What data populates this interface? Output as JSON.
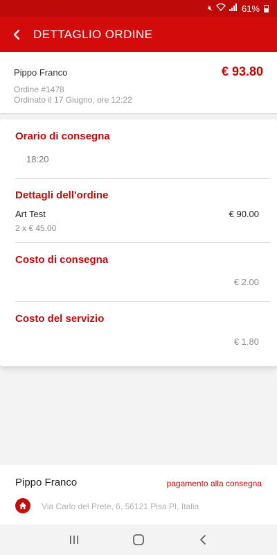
{
  "status_bar": {
    "battery_text": "61%",
    "icons": [
      "mute-icon",
      "wifi-icon",
      "signal-icon",
      "battery-icon"
    ]
  },
  "header": {
    "title": "DETTAGLIO ORDINE",
    "back_icon": "back-arrow-icon"
  },
  "summary": {
    "customer": "Pippo Franco",
    "total": "€ 93.80",
    "order_id": "Ordine #1478",
    "ordered_at": "Ordinato il 17 Giugno, ore 12:22"
  },
  "delivery_time": {
    "title": "Orario di consegna",
    "value": "18:20"
  },
  "order_details": {
    "title": "Dettagli dell'ordine",
    "items": [
      {
        "name": "Art Test",
        "price": "€ 90.00",
        "qty": "2 x € 45.00"
      }
    ]
  },
  "delivery_cost": {
    "title": "Costo di consegna",
    "value": "€ 2.00"
  },
  "service_cost": {
    "title": "Costo del servizio",
    "value": "€ 1.80"
  },
  "footer": {
    "name": "Pippo Franco",
    "payment": "pagamento alla consegna",
    "address": "Via Carlo del Prete, 6, 56121 Pisa PI, Italia",
    "address_icon": "home-icon"
  },
  "colors": {
    "brand": "#d40b0b",
    "accent_text": "#c20b0b"
  }
}
